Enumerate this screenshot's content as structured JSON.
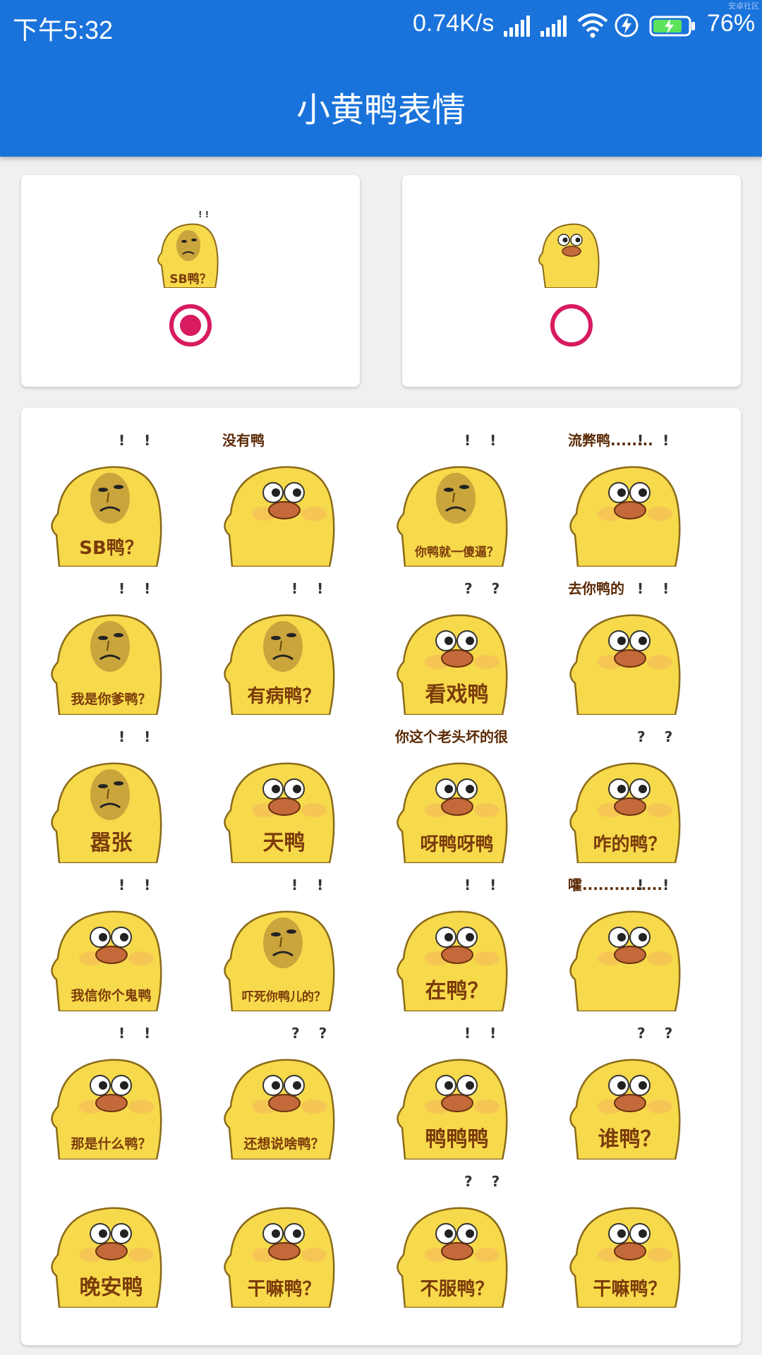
{
  "status_bar": {
    "time": "下午5:32",
    "net_speed": "0.74K/s",
    "battery": "76%",
    "watermark": "安卓社区",
    "icons": [
      "signal-icon",
      "signal-icon",
      "wifi-icon",
      "charging-bolt-icon",
      "battery-icon"
    ]
  },
  "app_bar": {
    "title": "小黄鸭表情"
  },
  "options": [
    {
      "caption": "SB鸭？",
      "face": "human",
      "selected": true
    },
    {
      "caption": "",
      "face": "duck",
      "selected": false
    }
  ],
  "colors": {
    "primary": "#1a73db",
    "accent": "#d81b60",
    "duck": "#f7d94c",
    "caption": "#7a3b0a"
  },
  "stickers": [
    {
      "caption": "SB鸭？",
      "top": "",
      "face": "human",
      "marks": "! !"
    },
    {
      "caption": "",
      "top": "没有鸭",
      "face": "duck",
      "marks": ""
    },
    {
      "caption": "你鸭就一傻逼？",
      "top": "",
      "face": "human",
      "marks": "! !"
    },
    {
      "caption": "",
      "top": "流弊鸭........",
      "face": "duck",
      "marks": "! !"
    },
    {
      "caption": "我是你爹鸭？",
      "top": "",
      "face": "human",
      "marks": "! !"
    },
    {
      "caption": "有病鸭？",
      "top": "",
      "face": "human",
      "marks": "! !"
    },
    {
      "caption": "看戏鸭",
      "top": "",
      "face": "duck",
      "marks": "? ?"
    },
    {
      "caption": "",
      "top": "去你鸭的",
      "face": "duck",
      "marks": "! !"
    },
    {
      "caption": "嚣张",
      "top": "",
      "face": "human",
      "marks": "! !"
    },
    {
      "caption": "天鸭",
      "top": "",
      "face": "duck",
      "marks": ""
    },
    {
      "caption": "呀鸭呀鸭",
      "top": "你这个老头坏的很",
      "face": "duck",
      "marks": ""
    },
    {
      "caption": "咋的鸭？",
      "top": "",
      "face": "duck",
      "marks": "? ?"
    },
    {
      "caption": "我信你个鬼鸭",
      "top": "",
      "face": "duck",
      "marks": "! !"
    },
    {
      "caption": "吓死你鸭儿的？",
      "top": "",
      "face": "human",
      "marks": "! !"
    },
    {
      "caption": "在鸭？",
      "top": "",
      "face": "duck",
      "marks": "! !"
    },
    {
      "caption": "",
      "top": "嚯...............",
      "face": "duck",
      "marks": "! !"
    },
    {
      "caption": "那是什么鸭？",
      "top": "",
      "face": "duck",
      "marks": "! !"
    },
    {
      "caption": "还想说啥鸭？",
      "top": "",
      "face": "duck",
      "marks": "? ?"
    },
    {
      "caption": "鸭鸭鸭",
      "top": "",
      "face": "duck",
      "marks": "! !"
    },
    {
      "caption": "谁鸭？",
      "top": "",
      "face": "duck",
      "marks": "? ?"
    },
    {
      "caption": "晚安鸭",
      "top": "",
      "face": "duck",
      "marks": ""
    },
    {
      "caption": "干嘛鸭？",
      "top": "",
      "face": "duck",
      "marks": ""
    },
    {
      "caption": "不服鸭？",
      "top": "",
      "face": "duck",
      "marks": "? ?"
    },
    {
      "caption": "干嘛鸭？",
      "top": "",
      "face": "duck",
      "marks": ""
    }
  ]
}
